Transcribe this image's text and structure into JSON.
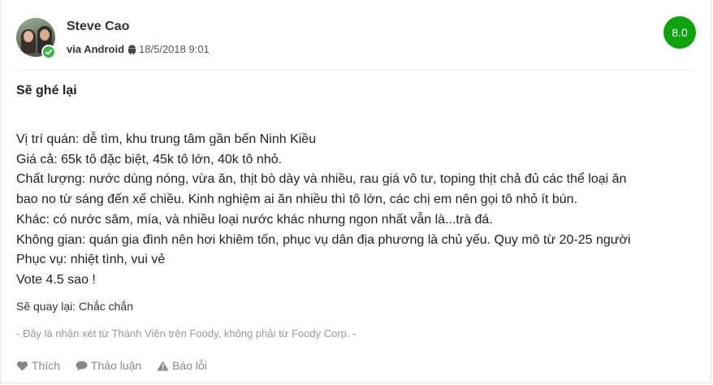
{
  "review": {
    "user_name": "Steve Cao",
    "via": "via Android",
    "timestamp": "18/5/2018 9:01",
    "score": "8.0",
    "title": "Sẽ ghé lại",
    "body_lines": [
      "Vị trí quán: dễ tìm, khu trung tâm gần bến Ninh Kiều",
      "Giá cả: 65k tô đặc biệt, 45k tô lớn, 40k tô nhỏ.",
      "Chất lượng: nước dùng nóng, vừa ăn, thịt bò dày và nhiều, rau giá vô tư, toping thịt chả đủ các thể loại ăn",
      "bao no từ sáng đến xế chiều. Kinh nghiệm ai ăn nhiều thì tô lớn, các chị em nên gọi tô nhỏ ít bún.",
      "Khác: có nước sâm, mía, và nhiều loại nước khác nhưng ngon nhất vẫn là...trà đá.",
      "Không gian: quán gia đình nên hơi khiêm tốn, phục vụ dân địa phương là chủ yếu. Quy mô từ 20-25 người",
      "Phục vụ: nhiệt tình, vui vẻ",
      "Vote 4.5 sao !"
    ],
    "revisit": "Sẽ quay lại: Chắc chắn",
    "disclaimer": "- Đây là nhận xét từ Thành Viên trên Foody, không phải từ Foody Corp. -"
  },
  "actions": {
    "like": "Thích",
    "discuss": "Thảo luận",
    "report": "Báo lỗi"
  },
  "colors": {
    "score_bg": "#0fa20f",
    "verified": "#3cb54a",
    "muted": "#999999"
  },
  "icons": [
    "verified-check-icon",
    "android-icon",
    "heart-icon",
    "comment-icon",
    "warning-icon"
  ]
}
